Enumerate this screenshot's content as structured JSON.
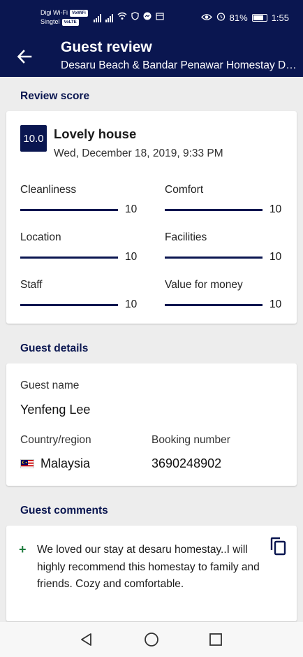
{
  "status_bar": {
    "carrier1": "Digi Wi-Fi",
    "carrier1_tag": "VoWiFi",
    "carrier2": "Singtel",
    "carrier2_tag": "VoLTE",
    "battery": "81%",
    "time": "1:55"
  },
  "app_bar": {
    "title": "Guest review",
    "subtitle": "Desaru Beach & Bandar Penawar Homestay Desaru Beach"
  },
  "review_score": {
    "section_label": "Review score",
    "score": "10.0",
    "title": "Lovely house",
    "date": "Wed, December 18, 2019, 9:33 PM",
    "metrics": [
      {
        "label": "Cleanliness",
        "value": "10",
        "fraction": 1.0
      },
      {
        "label": "Comfort",
        "value": "10",
        "fraction": 1.0
      },
      {
        "label": "Location",
        "value": "10",
        "fraction": 1.0
      },
      {
        "label": "Facilities",
        "value": "10",
        "fraction": 1.0
      },
      {
        "label": "Staff",
        "value": "10",
        "fraction": 1.0
      },
      {
        "label": "Value for money",
        "value": "10",
        "fraction": 1.0
      }
    ]
  },
  "guest_details": {
    "section_label": "Guest details",
    "name_label": "Guest name",
    "name": "Yenfeng Lee",
    "country_label": "Country/region",
    "country": "Malaysia",
    "booking_label": "Booking number",
    "booking_number": "3690248902"
  },
  "guest_comments": {
    "section_label": "Guest comments",
    "comment": "We loved our stay at desaru homestay..I will highly recommend this homestay to family and friends. Cozy and comfortable."
  },
  "colors": {
    "brand": "#0a1650",
    "positive": "#1b7a3b"
  }
}
